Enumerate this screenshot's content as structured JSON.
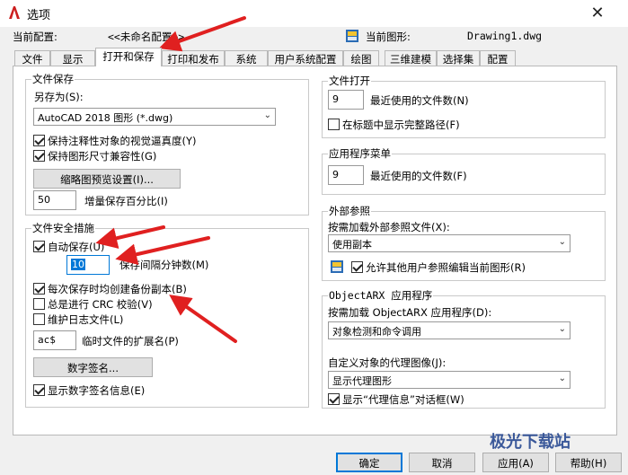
{
  "window": {
    "title": "选项"
  },
  "info": {
    "current_profile_label": "当前配置:",
    "current_profile_value": "<<未命名配置>>",
    "current_drawing_label": "当前图形:",
    "current_drawing_value": "Drawing1.dwg"
  },
  "tabs": [
    "文件",
    "显示",
    "打开和保存",
    "打印和发布",
    "系统",
    "用户系统配置",
    "绘图",
    "三维建模",
    "选择集",
    "配置"
  ],
  "file_save": {
    "legend": "文件保存",
    "save_as_label": "另存为(S):",
    "save_as_value": "AutoCAD 2018 图形 (*.dwg)",
    "maintain_visual_fidelity": "保持注释性对象的视觉逼真度(Y)",
    "maintain_drawing_size": "保持图形尺寸兼容性(G)",
    "thumbnail_button": "缩略图预览设置(I)...",
    "incremental_value": "50",
    "incremental_label": "增量保存百分比(I)"
  },
  "file_safety": {
    "legend": "文件安全措施",
    "autosave_label": "自动保存(U)",
    "autosave_minutes": "10",
    "autosave_minutes_label": "保存间隔分钟数(M)",
    "backup_label": "每次保存时均创建备份副本(B)",
    "crc_label": "总是进行 CRC 校验(V)",
    "log_label": "维护日志文件(L)",
    "temp_ext_value": "ac$",
    "temp_ext_label": "临时文件的扩展名(P)",
    "digital_sign_button": "数字签名...",
    "show_sign_info_label": "显示数字签名信息(E)"
  },
  "file_open": {
    "legend": "文件打开",
    "recent_value": "9",
    "recent_label": "最近使用的文件数(N)",
    "full_path_label": "在标题中显示完整路径(F)"
  },
  "app_menu": {
    "legend": "应用程序菜单",
    "recent_value": "9",
    "recent_label": "最近使用的文件数(F)"
  },
  "xref": {
    "legend": "外部参照",
    "demand_load_label": "按需加载外部参照文件(X):",
    "demand_load_value": "使用副本",
    "allow_edit_label": "允许其他用户参照编辑当前图形(R)"
  },
  "objectarx": {
    "legend": "ObjectARX 应用程序",
    "demand_load_label": "按需加载 ObjectARX 应用程序(D):",
    "demand_load_value": "对象检测和命令调用",
    "proxy_images_label": "自定义对象的代理图像(J):",
    "proxy_images_value": "显示代理图形",
    "show_proxy_info_label": "显示“代理信息”对话框(W)"
  },
  "buttons": {
    "ok": "确定",
    "cancel": "取消",
    "apply": "应用(A)",
    "help": "帮助(H)"
  },
  "watermark": "极光下载站",
  "colors": {
    "arrow": "#e02020",
    "accent": "#0078d7",
    "title_logo": "#cc1f1f"
  }
}
